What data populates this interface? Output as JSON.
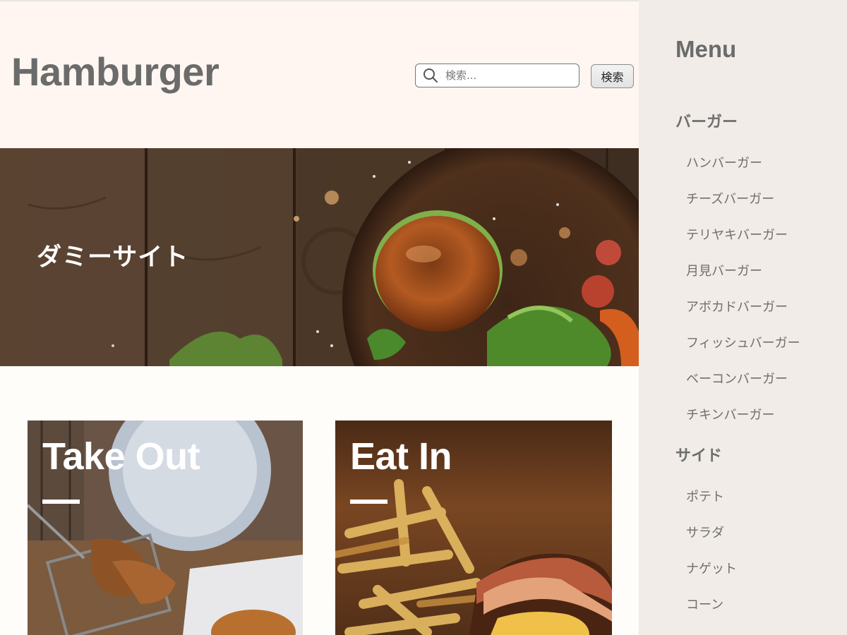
{
  "header": {
    "site_title": "Hamburger",
    "search_placeholder": "検索...",
    "search_button_label": "検索"
  },
  "hero": {
    "text": "ダミーサイト"
  },
  "cards": [
    {
      "title": "Take Out"
    },
    {
      "title": "Eat In"
    }
  ],
  "sidebar": {
    "title": "Menu",
    "categories": [
      {
        "label": "バーガー",
        "items": [
          "ハンバーガー",
          "チーズバーガー",
          "テリヤキバーガー",
          "月見バーガー",
          "アボカドバーガー",
          "フィッシュバーガー",
          "ベーコンバーガー",
          "チキンバーガー"
        ]
      },
      {
        "label": "サイド",
        "items": [
          "ポテト",
          "サラダ",
          "ナゲット",
          "コーン"
        ]
      }
    ]
  },
  "colors": {
    "header_bg": "#fff6f1",
    "sidebar_bg": "#f1ece7",
    "title_text": "#6b6b6b",
    "page_bg": "#fffdf9"
  },
  "icons": {
    "search": "search-icon"
  }
}
